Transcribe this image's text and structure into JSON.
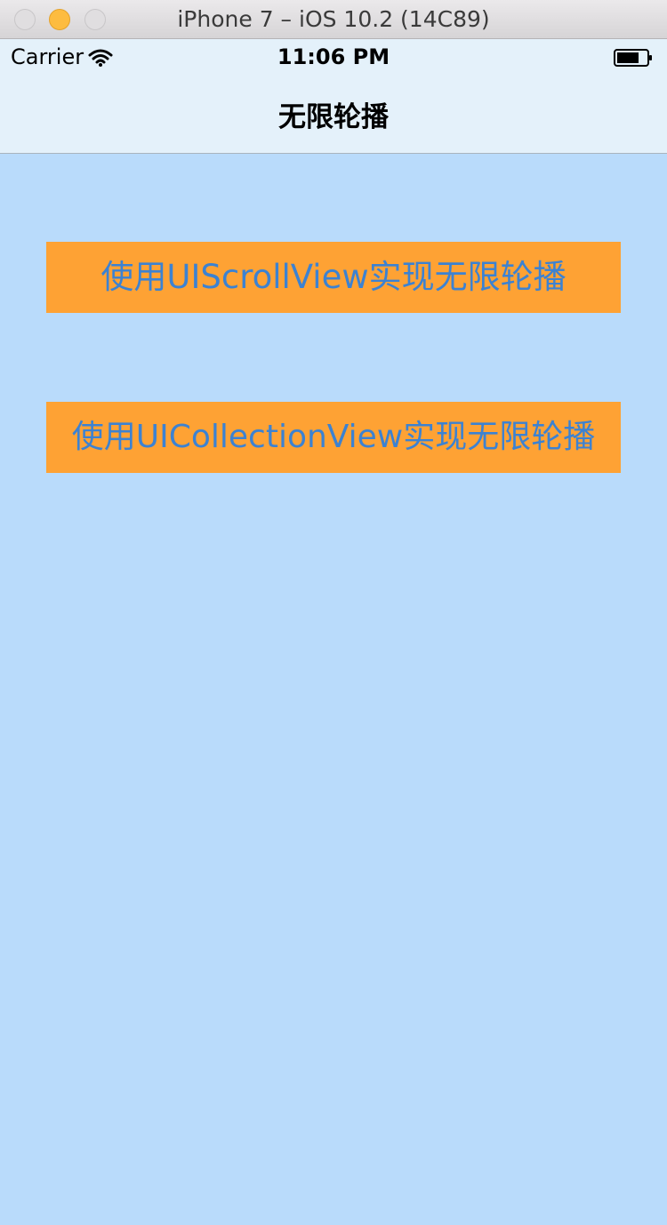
{
  "window": {
    "title": "iPhone 7 – iOS 10.2 (14C89)"
  },
  "status_bar": {
    "carrier": "Carrier",
    "time": "11:06 PM"
  },
  "nav": {
    "title": "无限轮播"
  },
  "buttons": {
    "scroll_view": "使用UIScrollView实现无限轮播",
    "collection_view": "使用UICollectionView实现无限轮播"
  },
  "colors": {
    "background": "#b9dbfb",
    "button_bg": "#fea234",
    "button_text": "#3c82d2",
    "nav_bg": "#e4f1fa"
  },
  "icons": [
    "wifi-icon",
    "battery-icon"
  ]
}
